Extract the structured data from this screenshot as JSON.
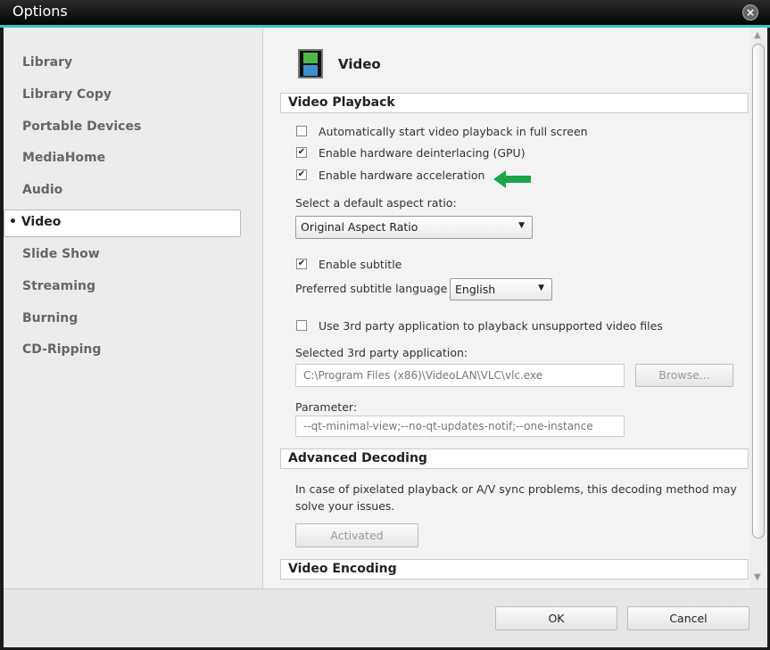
{
  "window": {
    "title": "Options"
  },
  "sidebar": {
    "items": [
      {
        "label": "Library"
      },
      {
        "label": "Library Copy"
      },
      {
        "label": "Portable Devices"
      },
      {
        "label": "MediaHome"
      },
      {
        "label": "Audio"
      },
      {
        "label": "• Video",
        "selected": true
      },
      {
        "label": "Slide Show"
      },
      {
        "label": "Streaming"
      },
      {
        "label": "Burning"
      },
      {
        "label": "CD-Ripping"
      }
    ]
  },
  "page": {
    "title": "Video",
    "icon": "film-icon"
  },
  "playback": {
    "header": "Video Playback",
    "fullscreen": {
      "label": "Automatically start video playback in full screen",
      "checked": false
    },
    "deinterlace": {
      "label": "Enable hardware deinterlacing (GPU)",
      "checked": true
    },
    "accel": {
      "label": "Enable hardware acceleration",
      "checked": true
    },
    "aspect_label": "Select a default aspect ratio:",
    "aspect_value": "Original Aspect Ratio",
    "subtitle": {
      "label": "Enable subtitle",
      "checked": true
    },
    "sub_lang_label": "Preferred subtitle language",
    "sub_lang_value": "English",
    "third": {
      "label": "Use 3rd party application to playback unsupported video files",
      "checked": false
    },
    "third_app_label": "Selected 3rd party application:",
    "third_app_value": "C:\\Program Files (x86)\\VideoLAN\\VLC\\vlc.exe",
    "browse": "Browse...",
    "param_label": "Parameter:",
    "param_value": "--qt-minimal-view;--no-qt-updates-notif;--one-instance"
  },
  "advanced": {
    "header": "Advanced Decoding",
    "text1": "In case of pixelated playback or A/V sync problems, this decoding method may",
    "text2": "solve your issues.",
    "button": "Activated"
  },
  "encoding": {
    "header": "Video Encoding"
  },
  "footer": {
    "ok": "OK",
    "cancel": "Cancel"
  },
  "colors": {
    "accent": "#35c6c6",
    "arrow": "#1aa54a"
  }
}
